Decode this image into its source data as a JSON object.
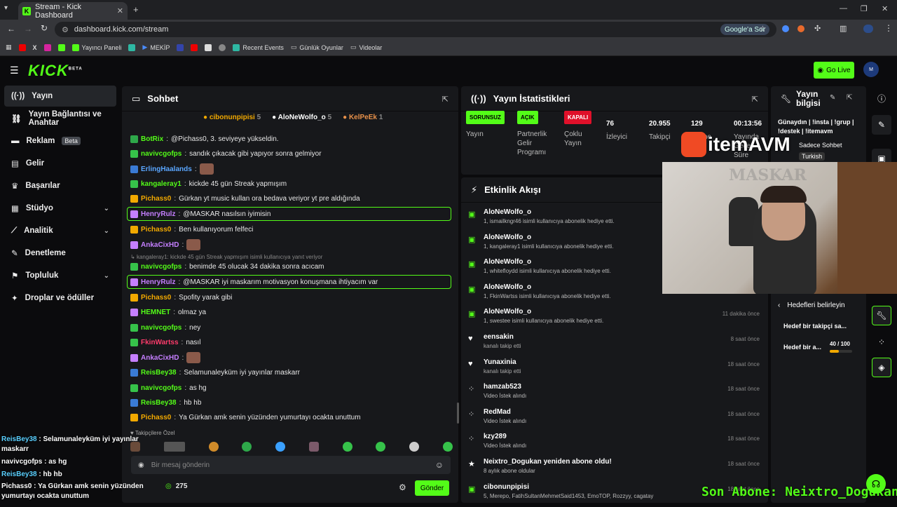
{
  "browser": {
    "tab_title": "Stream - Kick Dashboard",
    "url": "dashboard.kick.com/stream",
    "google_btn": "Google'a Sor",
    "bookmarks": [
      "Yayıncı Paneli",
      "MEKİP",
      "Recent Events",
      "Günlük Oyunlar",
      "Videolar"
    ]
  },
  "header": {
    "logo": "KICK",
    "logo_sup": "BETA",
    "go_live": "Go Live"
  },
  "sidebar": {
    "items": [
      {
        "label": "Yayın",
        "icon": "broadcast-icon"
      },
      {
        "label": "Yayın Bağlantısı ve Anahtar",
        "icon": "link-icon"
      },
      {
        "label": "Reklam",
        "icon": "ad-icon",
        "badge": "Beta"
      },
      {
        "label": "Gelir",
        "icon": "revenue-icon"
      },
      {
        "label": "Başarılar",
        "icon": "trophy-icon"
      },
      {
        "label": "Stüdyo",
        "icon": "studio-icon"
      },
      {
        "label": "Analitik",
        "icon": "analytics-icon"
      },
      {
        "label": "Denetleme",
        "icon": "moderation-icon"
      },
      {
        "label": "Topluluk",
        "icon": "community-icon"
      },
      {
        "label": "Droplar ve ödüller",
        "icon": "drops-icon"
      }
    ]
  },
  "chat": {
    "title": "Sohbet",
    "top_gifters": [
      {
        "name": "cibonunpipisi",
        "count": "5"
      },
      {
        "name": "AloNeWolfo_o",
        "count": "5"
      },
      {
        "name": "KelPeEk",
        "count": "1"
      }
    ],
    "messages": [
      {
        "user": "BotRix",
        "color": "#53fc18",
        "text": "@Pichass0, 3. seviyeye yükseldin."
      },
      {
        "user": "navivcgofps",
        "color": "#53fc18",
        "text": "sandık çıkacak gibi yapıyor sonra gelmiyor"
      },
      {
        "user": "ErlingHaalands",
        "color": "#5aa6ff",
        "text": ""
      },
      {
        "user": "kangaleray1",
        "color": "#53fc18",
        "text": "kickde 45 gün Streak yapmışım"
      },
      {
        "user": "Pichass0",
        "color": "#f2a900",
        "text": "Gürkan yt music kullan ora bedava veriyor yt pre aldığında"
      },
      {
        "user": "HenryRulz",
        "color": "#c57fff",
        "text": "@MASKAR nasılsın iyimisin"
      },
      {
        "user": "Pichass0",
        "color": "#f2a900",
        "text": "Ben kullanıyorum felfeci"
      },
      {
        "user": "AnkaCixHD",
        "color": "#c57fff",
        "text": ""
      },
      {
        "user": "navivcgofps",
        "color": "#53fc18",
        "text": "benimde 45 olucak 34 dakika sonra acıcam"
      },
      {
        "user": "HenryRulz",
        "color": "#c57fff",
        "text": "@MASKAR iyi maskarım motivasyon konuşmana ihtiyacım var"
      },
      {
        "user": "Pichass0",
        "color": "#f2a900",
        "text": "Spofity yarak gibi"
      },
      {
        "user": "HEMNET",
        "color": "#53fc18",
        "text": "olmaz ya"
      },
      {
        "user": "navivcgofps",
        "color": "#53fc18",
        "text": "ney"
      },
      {
        "user": "FkinWartss",
        "color": "#ff3b6b",
        "text": "nasıl"
      },
      {
        "user": "AnkaCixHD",
        "color": "#c57fff",
        "text": ""
      },
      {
        "user": "ReisBey38",
        "color": "#53fc18",
        "text": "Selamunaleyküm iyi yayınlar maskarr"
      },
      {
        "user": "navivcgofps",
        "color": "#53fc18",
        "text": "as hg"
      },
      {
        "user": "ReisBey38",
        "color": "#53fc18",
        "text": "hb hb"
      },
      {
        "user": "Pichass0",
        "color": "#f2a900",
        "text": "Ya Gürkan amk senin yüzünden yumurtayı ocakta unuttum"
      }
    ],
    "reply_hint": "kangaleray1: kickde 45 gün Streak yapmışım",
    "reply_suffix": "isimli kullanıcıya yanıt veriyor",
    "followers_only": "Takipçilere Özel",
    "input_placeholder": "Bir mesaj gönderin",
    "points": "275",
    "send": "Gönder"
  },
  "stats": {
    "title": "Yayın İstatistikleri",
    "items": [
      {
        "value": "SORUNSUZ",
        "label": "Yayın"
      },
      {
        "value": "AÇIK",
        "label": "Partnerlik Gelir Programı"
      },
      {
        "value": "KAPALI",
        "label": "Çoklu Yayın"
      },
      {
        "value": "76",
        "label": "İzleyici"
      },
      {
        "value": "20.955",
        "label": "Takipçi"
      },
      {
        "value": "129",
        "label": "Abone"
      },
      {
        "value": "00:13:56",
        "label": "Yayında Geçen Süre"
      }
    ]
  },
  "events": {
    "title": "Etkinlik Akışı",
    "items": [
      {
        "name": "AloNeWolfo_o",
        "sub": "1, ismailkngr46 isimli kullanıcıya abonelik hediye etti.",
        "time": "",
        "type": "gift"
      },
      {
        "name": "AloNeWolfo_o",
        "sub": "1, kangaleray1 isimli kullanıcıya abonelik hediye etti.",
        "time": "",
        "type": "gift"
      },
      {
        "name": "AloNeWolfo_o",
        "sub": "1, whitefloydd isimli kullanıcıya abonelik hediye etti.",
        "time": "",
        "type": "gift"
      },
      {
        "name": "AloNeWolfo_o",
        "sub": "1, FkinWartss isimli kullanıcıya abonelik hediye etti.",
        "time": "",
        "type": "gift"
      },
      {
        "name": "AloNeWolfo_o",
        "sub": "1, swestee isimli kullanıcıya abonelik hediye etti.",
        "time": "11 dakika önce",
        "type": "gift"
      },
      {
        "name": "eensakin",
        "sub": "kanalı takip etti",
        "time": "8 saat önce",
        "type": "follow"
      },
      {
        "name": "Yunaxinia",
        "sub": "kanalı takip etti",
        "time": "18 saat önce",
        "type": "follow"
      },
      {
        "name": "hamzab523",
        "sub": "Video İstek alındı",
        "time": "18 saat önce",
        "type": "redeem"
      },
      {
        "name": "RedMad",
        "sub": "Video İstek alındı",
        "time": "18 saat önce",
        "type": "redeem"
      },
      {
        "name": "kzy289",
        "sub": "Video İstek alındı",
        "time": "18 saat önce",
        "type": "redeem"
      },
      {
        "name": "Neixtro_Dogukan yeniden abone oldu!",
        "sub": "8 aylık abone oldular",
        "time": "18 saat önce",
        "type": "sub"
      },
      {
        "name": "cibonunpipisi",
        "sub": "5, Merepo, FatihSultanMehmetSaid1453, EmoTOP, Rozzyy, cagatay",
        "time": "18 saat önce",
        "type": "gift"
      }
    ]
  },
  "info": {
    "title": "Yayın bilgisi",
    "stream_title": "Günaydın | !insta | !grup | !destek | !itemavm",
    "chat_mode": "Sadece Sohbet",
    "language": "Turkish",
    "goals_header": "Hedefleri belirleyin",
    "goal1": "Hedef bir takipçi sa...",
    "goal2": "Hedef bir a...",
    "goal2_progress": "40 / 100",
    "goal2_fraction": 0.4
  },
  "overlay": {
    "brand": "itemAVM",
    "watermark": "MASKAR",
    "new_sub": "Son Abone: Neixtro_Dogukan",
    "chat": [
      {
        "user": "ReisBey38",
        "text": "Selamunaleyküm iyi yayınlar maskarr"
      },
      {
        "user": "navivcgofps",
        "text": "as hg"
      },
      {
        "user": "ReisBey38",
        "text": "hb hb"
      },
      {
        "user": "Pichass0",
        "text": "Ya Gürkan amk senin yüzünden yumurtayı ocakta unuttum"
      }
    ]
  },
  "colors": {
    "accent": "#53fc18",
    "panel": "#17181b",
    "bg": "#0b0b0d",
    "danger": "#e0102a"
  }
}
